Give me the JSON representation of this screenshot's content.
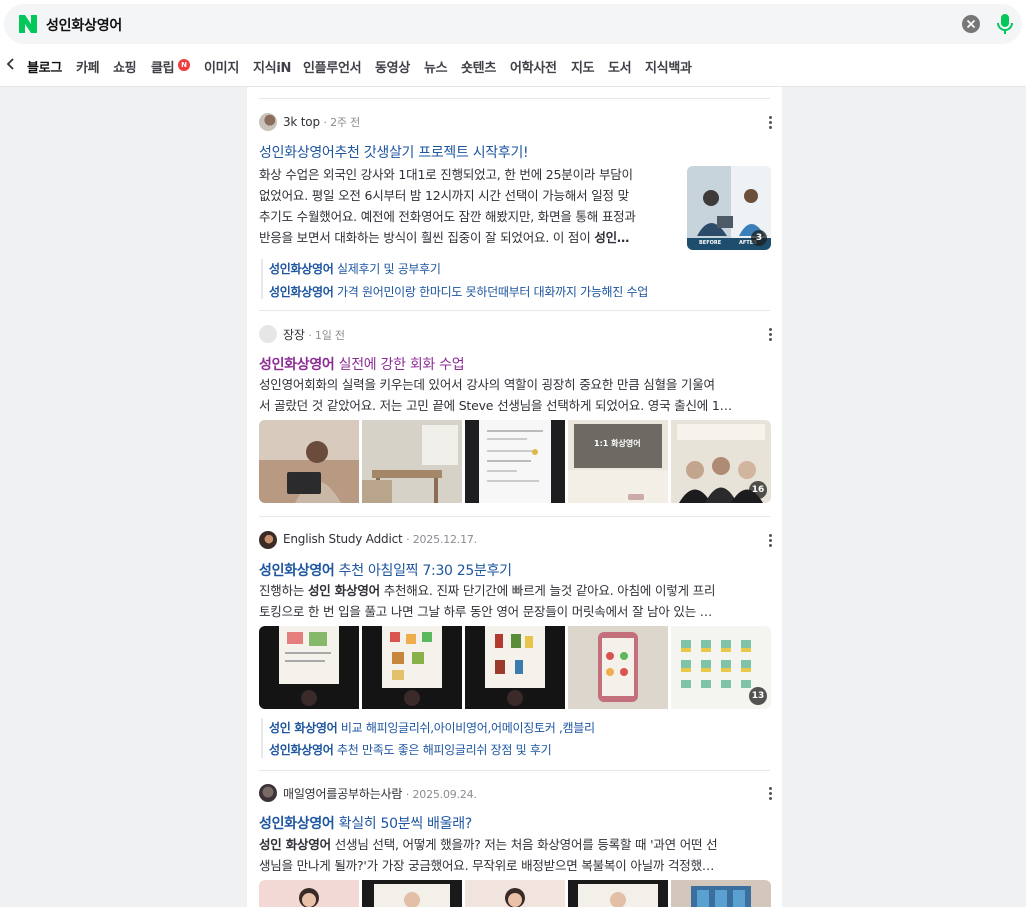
{
  "search": {
    "query": "성인화상영어"
  },
  "tabs": [
    {
      "label": "블로그",
      "active": true
    },
    {
      "label": "카페"
    },
    {
      "label": "쇼핑"
    },
    {
      "label": "클립",
      "badge": "N"
    },
    {
      "label": "이미지"
    },
    {
      "label": "지식iN"
    },
    {
      "label": "인플루언서"
    },
    {
      "label": "동영상"
    },
    {
      "label": "뉴스"
    },
    {
      "label": "숏텐츠"
    },
    {
      "label": "어학사전"
    },
    {
      "label": "지도"
    },
    {
      "label": "도서"
    },
    {
      "label": "지식백과"
    }
  ],
  "posts": [
    {
      "author": "3k top",
      "time": "2주 전",
      "title": "성인화상영어추천 갓생살기 프로젝트 시작후기!",
      "desc_lines": [
        "화상 수업은 외국인 강사와 1대1로 진행되었고, 한 번에 25분이라 부담이",
        "없었어요. 평일 오전 6시부터 밤 12시까지 시간 선택이 가능해서 일정 맞",
        "추기도 수월했어요. 예전에 전화영어도 잠깐 해봤지만, 화면을 통해 표정과",
        "반응을 보면서 대화하는 방식이 훨씬 집중이 잘 되었어요. 이 점이 "
      ],
      "desc_tail_bold": "성인…",
      "thumb_count": "3",
      "thumb_before": "BEFORE",
      "thumb_after": "AFTER",
      "sublinks": [
        {
          "bold": "성인화상영어",
          "rest": " 실제후기 및 공부후기"
        },
        {
          "bold": "성인화상영어",
          "rest": " 가격 원어민이랑 한마디도 못하던때부터 대화까지 가능해진 수업"
        }
      ]
    },
    {
      "author": "장장",
      "time": "1일 전",
      "title_bold": "성인화상영어",
      "title_rest": " 실전에 강한 회화 수업",
      "desc_lines": [
        "성인영어회화의 실력을 키우는데 있어서 강사의 역할이 굉장히 중요한 만큼 심혈을 기울여",
        "서 골랐던 것 같았어요. 저는 고민 끝에 Steve 선생님을 선택하게 되었어요. 영국 출신에 1…"
      ],
      "strip_count": "16",
      "strip_caption": "1:1 화상영어"
    },
    {
      "author": "English Study Addict",
      "time": "2025.12.17.",
      "title_bold": "성인화상영어",
      "title_rest": " 추천 아침일찍 7:30 25분후기",
      "desc_pre": "진행하는 ",
      "desc_bold": "성인 화상영어",
      "desc_post": " 추천해요. 진짜 단기간에 빠르게 늘것 같아요. 아침에 이렇게 프리",
      "desc_line2": "토킹으로 한 번 입을 풀고 나면 그날 하루 동안 영어 문장들이 머릿속에서 잘 남아 있는 …",
      "strip_count": "13",
      "sublinks": [
        {
          "bold": "성인 화상영어",
          "rest": " 비교 해피잉글리쉬,아이비영어,어메이징토커 ,캠블리"
        },
        {
          "bold": "성인화상영어",
          "rest": " 추천 만족도 좋은 해피잉글리쉬 장점 및 후기"
        }
      ]
    },
    {
      "author": "매일영어를공부하는사람",
      "time": "2025.09.24.",
      "title_bold": "성인화상영어",
      "title_rest": " 확실히 50분씩 배울래?",
      "desc_bold": "성인 화상영어",
      "desc_post": " 선생님 선택, 어떻게 했을까? 저는 처음 화상영어를 등록할 때 '과연 어떤 선",
      "desc_line2": "생님을 만나게 될까?'가 가장 궁금했어요. 무작위로 배정받으면 복불복이 아닐까 걱정했…"
    }
  ],
  "colors": {
    "brand": "#03c75a",
    "link": "#1e56a0",
    "visited": "#8c2d96"
  }
}
